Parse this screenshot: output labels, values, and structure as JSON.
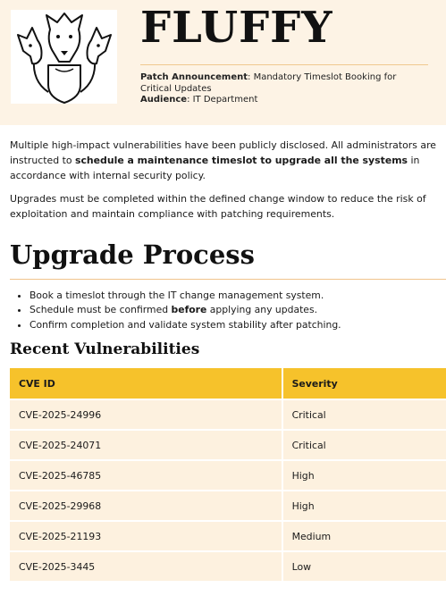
{
  "header": {
    "brand": "FLUFFY",
    "logo_icon": "three-headed-dog-shield-icon",
    "announcement_label": "Patch Announcement",
    "announcement_text": ": Mandatory Timeslot Booking for Critical Updates",
    "audience_label": "Audience",
    "audience_text": ": IT Department"
  },
  "intro": {
    "p1_start": "Multiple high-impact vulnerabilities have been publicly disclosed. All administrators are instructed to ",
    "p1_bold": "schedule a maintenance timeslot to upgrade all the systems",
    "p1_end": " in accordance with internal security policy.",
    "p2": "Upgrades must be completed within the defined change window to reduce the risk of exploitation and maintain compliance with patching requirements."
  },
  "process": {
    "title": "Upgrade Process",
    "step1": "Book a timeslot through the IT change management system.",
    "step2_start": "Schedule must be confirmed ",
    "step2_bold": "before",
    "step2_end": " applying any updates.",
    "step3": "Confirm completion and validate system stability after patching."
  },
  "vulnerabilities": {
    "title": "Recent Vulnerabilities",
    "col_cve": "CVE ID",
    "col_severity": "Severity",
    "rows": [
      {
        "cve": "CVE-2025-24996",
        "severity": "Critical"
      },
      {
        "cve": "CVE-2025-24071",
        "severity": "Critical"
      },
      {
        "cve": "CVE-2025-46785",
        "severity": "High"
      },
      {
        "cve": "CVE-2025-29968",
        "severity": "High"
      },
      {
        "cve": "CVE-2025-21193",
        "severity": "Medium"
      },
      {
        "cve": "CVE-2025-3445",
        "severity": "Low"
      }
    ]
  },
  "colors": {
    "header_bg": "#fdf3e5",
    "table_header_bg": "#f6c22b",
    "table_row_bg": "#fdf1df",
    "rule": "#f0c48c"
  }
}
